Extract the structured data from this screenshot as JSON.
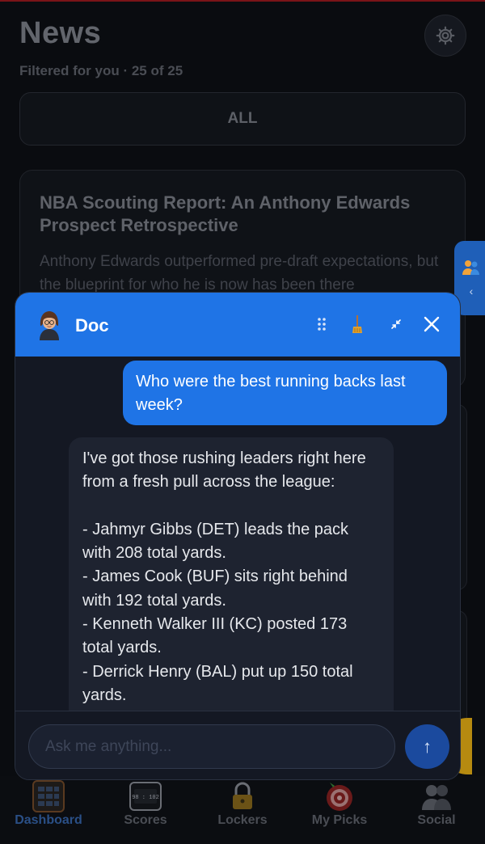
{
  "page": {
    "title": "News",
    "subtitle": "Filtered for you · 25 of 25",
    "filter_label": "ALL"
  },
  "news_card": {
    "title": "NBA Scouting Report: An Anthony Edwards Prospect Retrospective",
    "snippet": "Anthony Edwards outperformed pre-draft expectations, but the blueprint for who he is now has been there"
  },
  "chat": {
    "assistant_name": "Doc",
    "header_icons": [
      "drag-handle-icon",
      "broom-icon",
      "collapse-icon",
      "close-icon"
    ],
    "messages": [
      {
        "role": "user",
        "text": "Who were the best running backs last week?"
      },
      {
        "role": "assistant",
        "text": "I've got those rushing leaders right here from a fresh pull across the league:\n\n- Jahmyr Gibbs (DET) leads the pack with 208 total yards.\n- James Cook (BUF) sits right behind with 192 total yards.\n- Kenneth Walker III (KC) posted 173 total yards.\n- Derrick Henry (BAL) put up 150 total yards."
      }
    ],
    "input_placeholder": "Ask me anything...",
    "send_icon": "up-arrow-icon"
  },
  "nav": {
    "items": [
      {
        "label": "Dashboard",
        "icon": "dashboard-icon",
        "active": true
      },
      {
        "label": "Scores",
        "icon": "scoreboard-icon",
        "scoreboard_text": "98 : 102"
      },
      {
        "label": "Lockers",
        "icon": "lock-icon"
      },
      {
        "label": "My Picks",
        "icon": "target-icon"
      },
      {
        "label": "Social",
        "icon": "people-icon"
      }
    ]
  },
  "colors": {
    "accent": "#1f74e6",
    "background": "#0a0c10",
    "chat_bg": "#141823",
    "bot_bubble": "#1e2330"
  }
}
